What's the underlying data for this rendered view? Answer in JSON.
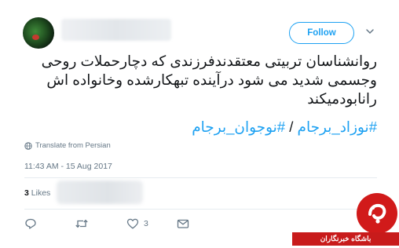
{
  "header": {
    "follow_label": "Follow"
  },
  "tweet": {
    "text_line1": "روانشناسان تربیتی معتقدندفرزندی که دچارحملات روحی",
    "text_line2": "وجسمی شدید می شود درآینده تبهکارشده وخانواده اش",
    "text_line3": "رانابودمیکند",
    "hashtag1": "#نوزاد_برجام",
    "separator": "/",
    "hashtag2": "#نوجوان_برجام",
    "translate_label": "Translate from Persian",
    "timestamp": "11:43 AM - 15 Aug 2017"
  },
  "stats": {
    "likes_count": "3",
    "likes_label": "Likes"
  },
  "actions": {
    "like_count": "3"
  },
  "watermark": {
    "text": "باشگاه خبرنگاران"
  },
  "colors": {
    "accent": "#1da1f2",
    "text": "#14171a",
    "muted": "#657786",
    "watermark_red": "#c81b1b"
  }
}
